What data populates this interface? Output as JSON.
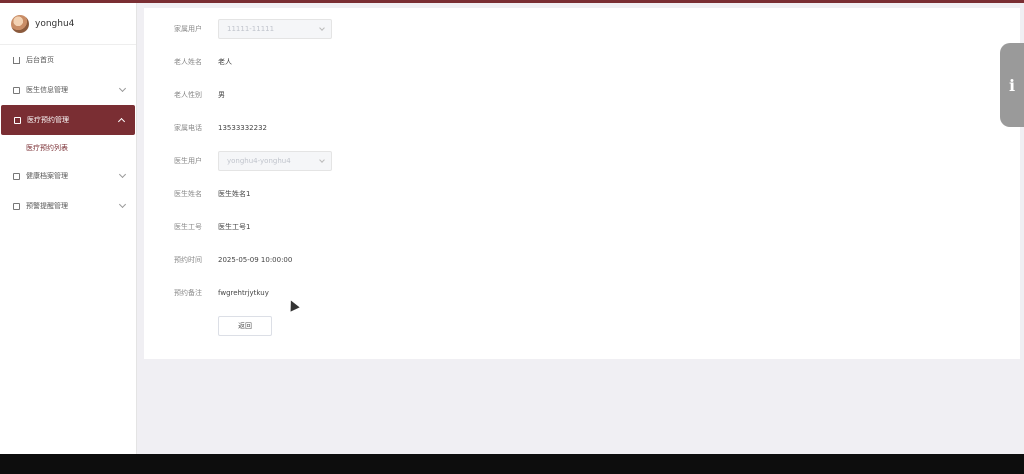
{
  "user": {
    "name": "yonghu4"
  },
  "sidebar": {
    "items": [
      {
        "label": "后台首页",
        "icon": "home-icon"
      },
      {
        "label": "医生信息管理",
        "icon": "document-icon"
      },
      {
        "label": "医疗预约管理",
        "icon": "document-icon",
        "active": true
      },
      {
        "label": "健康档案管理",
        "icon": "document-icon"
      },
      {
        "label": "预警提醒管理",
        "icon": "document-icon"
      }
    ],
    "subitem": {
      "label": "医疗预约列表"
    }
  },
  "form": {
    "family_user": {
      "label": "家属用户",
      "value": "11111-11111"
    },
    "elder_name": {
      "label": "老人姓名",
      "value": "老人"
    },
    "elder_gender": {
      "label": "老人性别",
      "value": "男"
    },
    "family_phone": {
      "label": "家属电话",
      "value": "13533332232"
    },
    "doctor_user": {
      "label": "医生用户",
      "value": "yonghu4-yonghu4"
    },
    "doctor_name": {
      "label": "医生姓名",
      "value": "医生姓名1"
    },
    "doctor_id": {
      "label": "医生工号",
      "value": "医生工号1"
    },
    "appointment_time": {
      "label": "预约时间",
      "value": "2025-05-09 10:00:00"
    },
    "appointment_note": {
      "label": "预约备注",
      "value": "fwgrehtrjytkuy"
    }
  },
  "buttons": {
    "back_label": "返回"
  },
  "colors": {
    "accent": "#7a2e33",
    "background": "#f0eff3"
  }
}
